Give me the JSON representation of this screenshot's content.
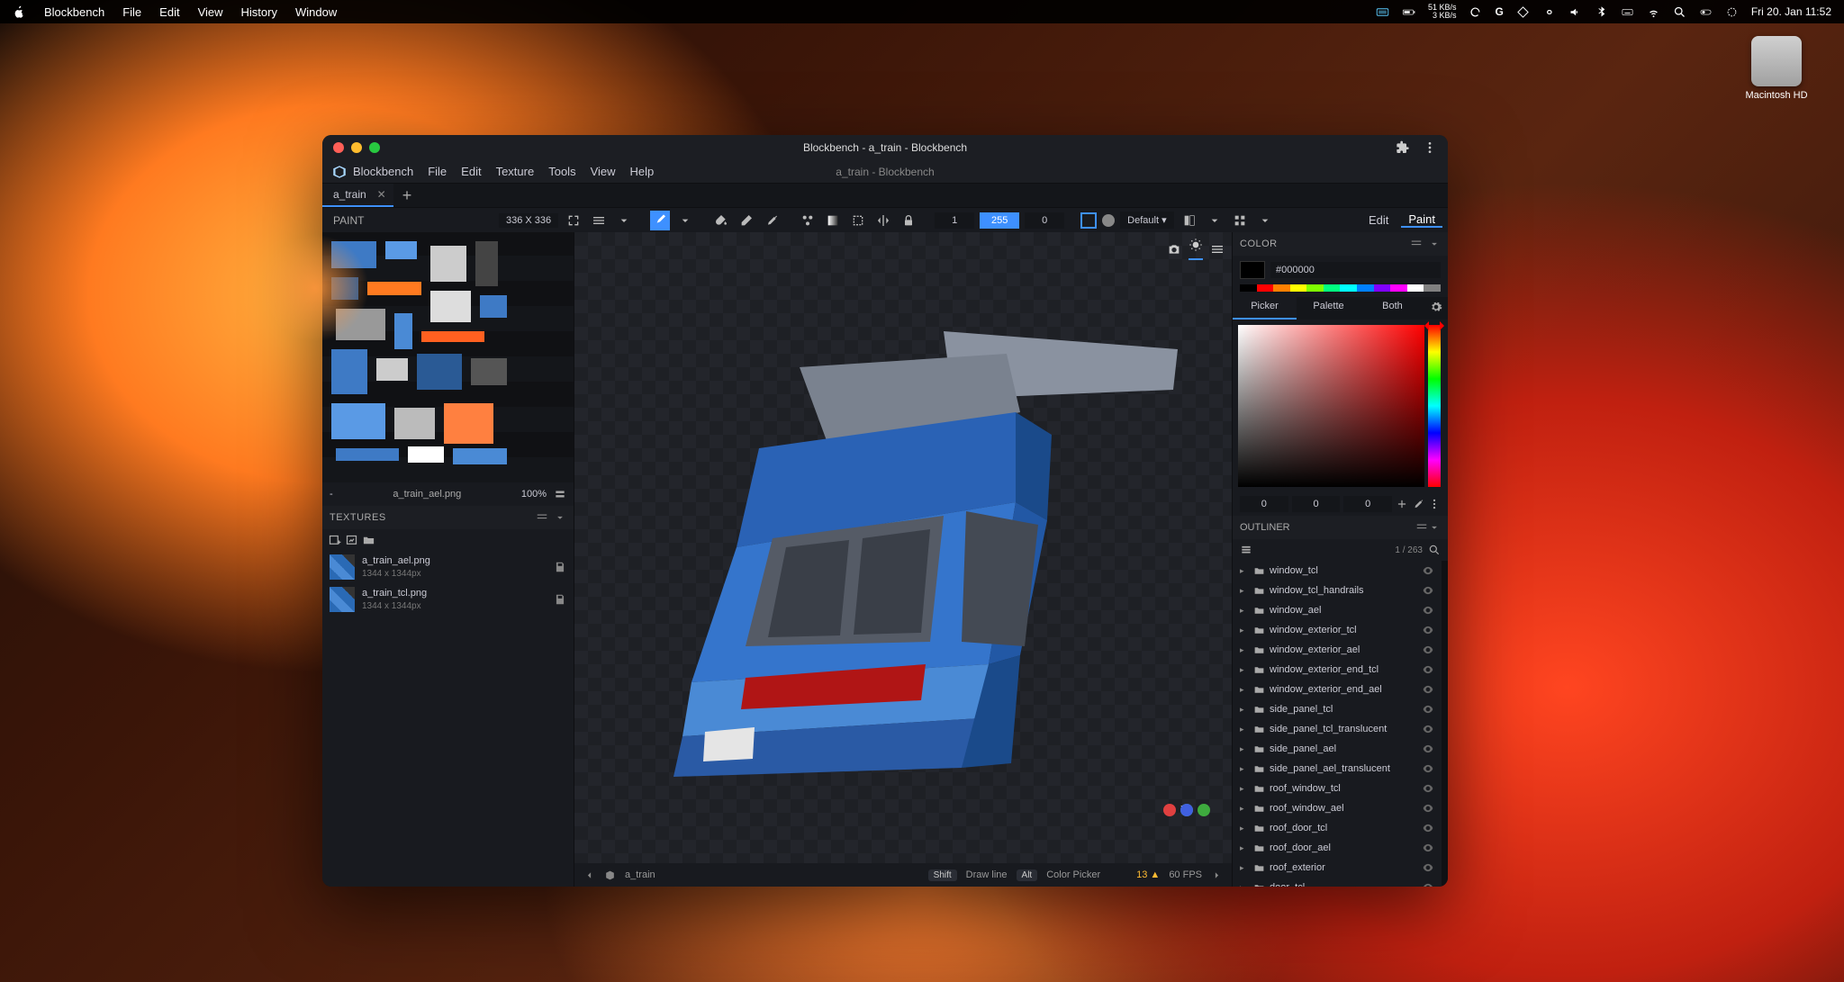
{
  "menubar": {
    "app": "Blockbench",
    "items": [
      "File",
      "Edit",
      "View",
      "History",
      "Window"
    ],
    "net_up": "51 KB/s",
    "net_down": "3 KB/s",
    "clock": "Fri 20. Jan  11:52"
  },
  "desktop": {
    "hd_label": "Macintosh HD"
  },
  "window": {
    "title": "Blockbench - a_train - Blockbench",
    "subtitle": "a_train - Blockbench"
  },
  "app_menu": [
    "File",
    "Edit",
    "Texture",
    "Tools",
    "View",
    "Help"
  ],
  "tab": {
    "name": "a_train"
  },
  "toolbar": {
    "mode_label": "PAINT",
    "resolution": "336 X 336",
    "brush_size": "1",
    "brush_opacity": "255",
    "brush_soft": "0",
    "brush_mode": "Default",
    "modes": {
      "edit": "Edit",
      "paint": "Paint"
    }
  },
  "uv": {
    "file": "a_train_ael.png",
    "zoom": "100%",
    "dash": "-"
  },
  "textures": {
    "title": "TEXTURES",
    "items": [
      {
        "name": "a_train_ael.png",
        "dim": "1344 x 1344px"
      },
      {
        "name": "a_train_tcl.png",
        "dim": "1344 x 1344px"
      }
    ]
  },
  "color": {
    "title": "COLOR",
    "hex": "#000000",
    "tabs": {
      "picker": "Picker",
      "palette": "Palette",
      "both": "Both"
    },
    "swatches": [
      "#000000",
      "#ff0000",
      "#ff8000",
      "#ffff00",
      "#80ff00",
      "#00ff80",
      "#00ffff",
      "#0080ff",
      "#8000ff",
      "#ff00ff",
      "#ffffff",
      "#808080"
    ],
    "r": "0",
    "g": "0",
    "b": "0"
  },
  "outliner": {
    "title": "OUTLINER",
    "count": "1 / 263",
    "items": [
      "window_tcl",
      "window_tcl_handrails",
      "window_ael",
      "window_exterior_tcl",
      "window_exterior_ael",
      "window_exterior_end_tcl",
      "window_exterior_end_ael",
      "side_panel_tcl",
      "side_panel_tcl_translucent",
      "side_panel_ael",
      "side_panel_ael_translucent",
      "roof_window_tcl",
      "roof_window_ael",
      "roof_door_tcl",
      "roof_door_ael",
      "roof_exterior",
      "door_tcl"
    ]
  },
  "status": {
    "name": "a_train",
    "shift_key": "Shift",
    "shift_act": "Draw line",
    "alt_key": "Alt",
    "alt_act": "Color Picker",
    "warn_n": "13",
    "fps": "60 FPS"
  }
}
